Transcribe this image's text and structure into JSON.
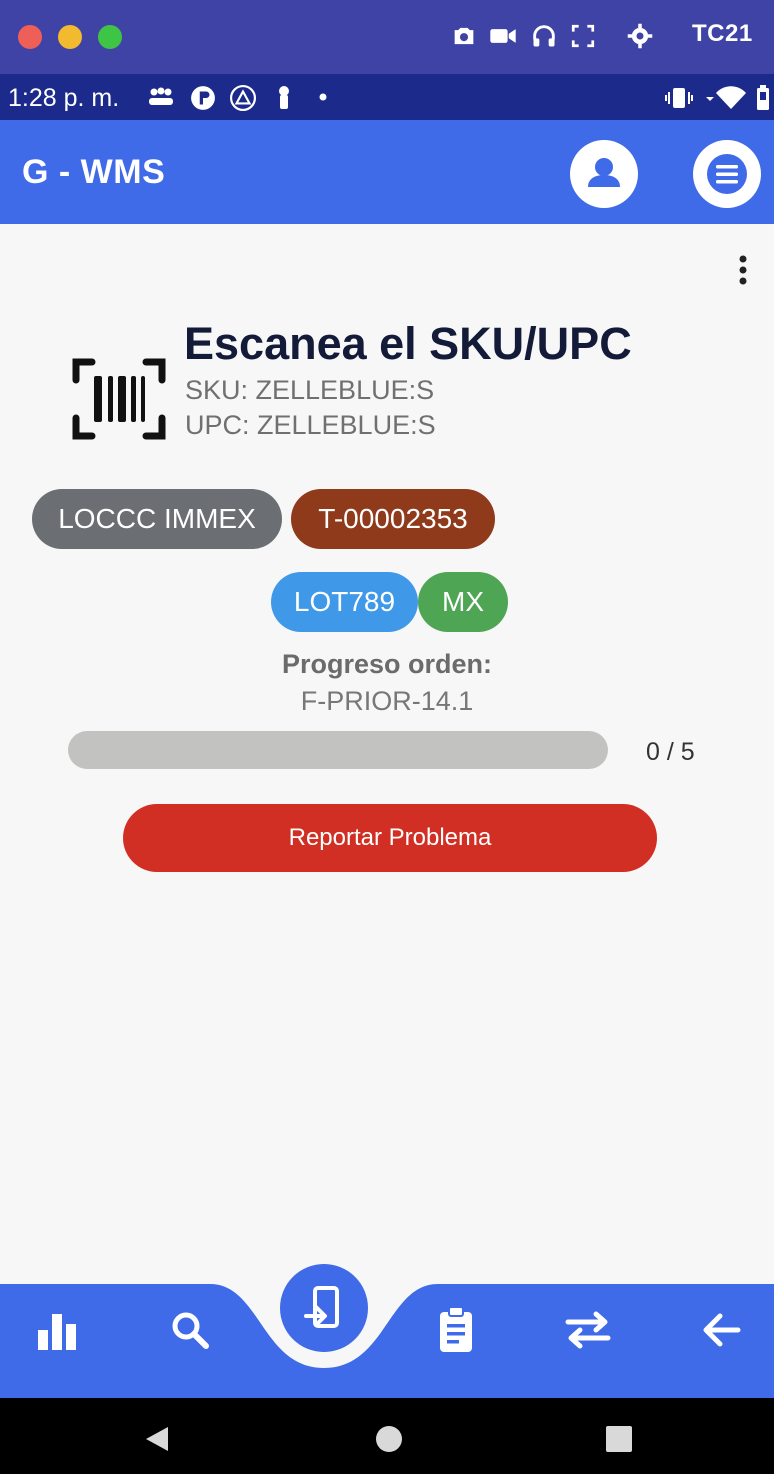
{
  "window": {
    "title": "TC21",
    "icons": [
      "camera-icon",
      "video-icon",
      "headphones-icon",
      "fullscreen-icon",
      "gear-icon"
    ]
  },
  "status_bar": {
    "time": "1:28 p. m."
  },
  "app": {
    "title": "G - WMS"
  },
  "scan": {
    "title": "Escanea el SKU/UPC",
    "sku": "SKU: ZELLEBLUE:S",
    "upc": "UPC: ZELLEBLUE:S"
  },
  "chips": {
    "location": "LOCCC IMMEX",
    "task": "T-00002353",
    "lot": "LOT789",
    "country": "MX"
  },
  "progress": {
    "label": "Progreso orden:",
    "order": "F-PRIOR-14.1",
    "count": "0 / 5",
    "fraction": 0
  },
  "actions": {
    "report": "Reportar Problema"
  },
  "bottom_nav": [
    "chart-icon",
    "search-icon",
    "scan-to-device-icon",
    "clipboard-icon",
    "transfer-icon",
    "back-arrow-icon"
  ],
  "colors": {
    "primary": "#3f6ae8",
    "danger": "#d12f24",
    "task_chip": "#8f3a1b",
    "location_chip": "#6b6e72",
    "lot_chip": "#3f98e8",
    "country_chip": "#4ea553"
  }
}
